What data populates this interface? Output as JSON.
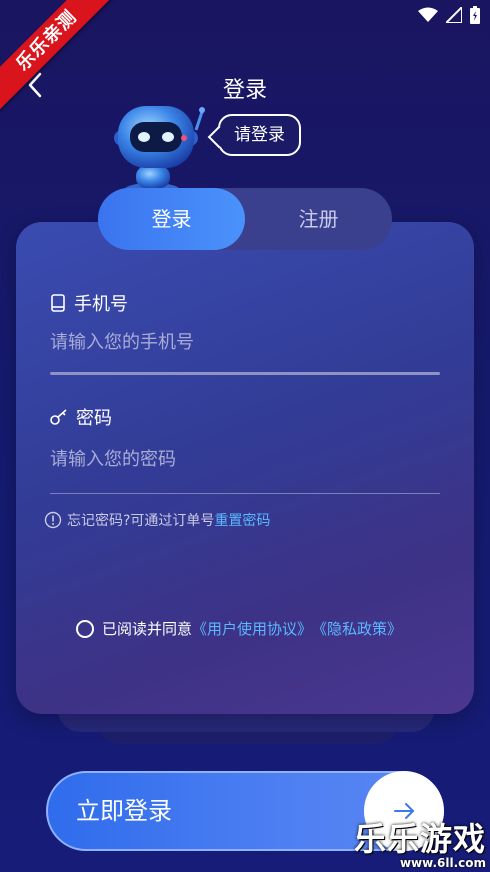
{
  "ribbon": {
    "text": "乐乐亲测"
  },
  "header": {
    "title": "登录"
  },
  "robot": {
    "bubble": "请登录"
  },
  "tabs": {
    "login": "登录",
    "register": "注册"
  },
  "form": {
    "phone_label": "手机号",
    "phone_placeholder": "请输入您的手机号",
    "password_label": "密码",
    "password_placeholder": "请输入您的密码",
    "forgot_text": "忘记密码?可通过订单号",
    "forgot_link": "重置密码"
  },
  "agreement": {
    "prefix": "已阅读并同意",
    "user_agreement": "《用户使用协议》",
    "privacy_policy": "《隐私政策》"
  },
  "login_button": {
    "label": "立即登录"
  },
  "watermark": {
    "title": "乐乐游戏",
    "url": "www.6ll.com"
  },
  "colors": {
    "accent": "#4b92fb",
    "link": "#5ab8ff",
    "background": "#151a6e"
  },
  "icons": [
    "wifi-icon",
    "signal-icon",
    "battery-icon",
    "back-arrow-icon",
    "phone-icon",
    "key-icon",
    "info-icon",
    "radio-circle-icon",
    "arrow-right-icon"
  ]
}
